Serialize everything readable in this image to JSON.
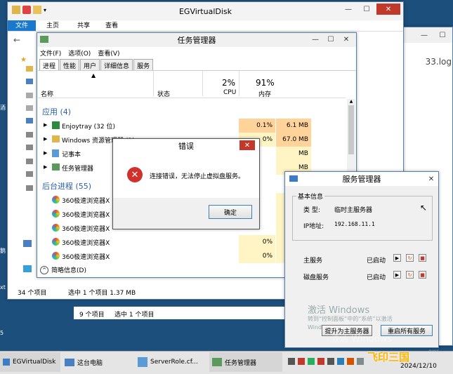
{
  "explorer": {
    "title": "EGVirtualDisk",
    "ribbon_tabs": [
      "文件",
      "主页",
      "共享",
      "查看"
    ],
    "status_items": "34 个项目",
    "status_selected": "选中 1 个项目  1.37 MB",
    "left_labels": [
      "酒",
      "a",
      "s",
      "t",
      "s",
      "s",
      "鹅",
      "xt",
      "5"
    ]
  },
  "explorer2": {
    "status_items": "9 个项目",
    "status_selected": "选中 1 个项目",
    "log_text": "33.log"
  },
  "task_manager": {
    "title": "任务管理器",
    "menu": [
      "文件(F)",
      "选项(O)",
      "查看(V)"
    ],
    "tabs": [
      "进程",
      "性能",
      "用户",
      "详细信息",
      "服务"
    ],
    "col_name": "名称",
    "col_status": "状态",
    "cpu_pct": "2%",
    "mem_pct": "91%",
    "col_cpu": "CPU",
    "col_mem": "内存",
    "group_apps": "应用 (4)",
    "group_bg": "后台进程 (55)",
    "apps": [
      {
        "name": "Enjoytray (32 位)",
        "cpu": "0.1%",
        "mem": "6.1 MB"
      },
      {
        "name": "Windows 资源管理器 (2)",
        "cpu": "0%",
        "mem": "67.0 MB"
      },
      {
        "name": "记事本",
        "cpu": "",
        "mem": "MB"
      },
      {
        "name": "任务管理器",
        "cpu": "",
        "mem": "MB"
      }
    ],
    "bg": [
      {
        "name": "360极速浏览器X",
        "cpu": "",
        "mem": "MB"
      },
      {
        "name": "360极速浏览器X",
        "cpu": "",
        "mem": "MB"
      },
      {
        "name": "360极速浏览器X",
        "cpu": "",
        "mem": "MB"
      },
      {
        "name": "360极速浏览器X",
        "cpu": "0%",
        "mem": "3.5 MB"
      },
      {
        "name": "360极速浏览器X",
        "cpu": "0%",
        "mem": "5.1 MB"
      }
    ],
    "footer": "简略信息(D)"
  },
  "error_dialog": {
    "title": "错误",
    "message": "连接错误，无法停止虚拟盘服务。",
    "ok": "确定"
  },
  "service_manager": {
    "title": "服务管理器",
    "group_label": "基本信息",
    "type_label": "类 型:",
    "type_value": "临时主服务器",
    "ip_label": "IP地址:",
    "ip_value": "192.168.11.1",
    "main_service": "主服务",
    "main_status": "已启动",
    "disk_service": "磁盘服务",
    "disk_status": "已启动",
    "btn_promote": "提升为主服务器",
    "btn_restart": "重启所有服务"
  },
  "watermark": {
    "line1": "激活 Windows",
    "line2": "转到“控制面板”中的“系统”以激活",
    "line3": "Windows。",
    "line4": "激活 Windows",
    "line5": "ows。"
  },
  "taskbar": {
    "items": [
      "EGVirtualDisk",
      "这台电脑",
      "ServerRole.cf...",
      "任务管理器"
    ],
    "date": "2024/12/10",
    "brand": "飞印三国"
  }
}
